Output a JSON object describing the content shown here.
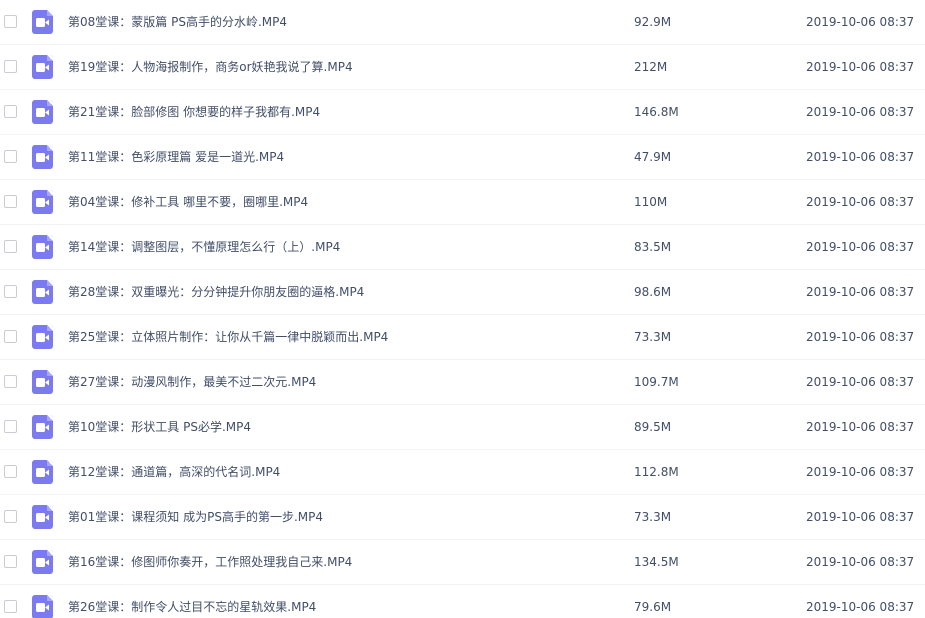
{
  "colors": {
    "icon_bg": "#7b7af0",
    "text": "#424e67",
    "row_divider": "#f2f2f3"
  },
  "files": [
    {
      "name": "第08堂课：蒙版篇 PS高手的分水岭.MP4",
      "size": "92.9M",
      "date": "2019-10-06 08:37",
      "icon": "video-file-icon"
    },
    {
      "name": "第19堂课：人物海报制作，商务or妖艳我说了算.MP4",
      "size": "212M",
      "date": "2019-10-06 08:37",
      "icon": "video-file-icon"
    },
    {
      "name": "第21堂课：脸部修图 你想要的样子我都有.MP4",
      "size": "146.8M",
      "date": "2019-10-06 08:37",
      "icon": "video-file-icon"
    },
    {
      "name": "第11堂课：色彩原理篇 爱是一道光.MP4",
      "size": "47.9M",
      "date": "2019-10-06 08:37",
      "icon": "video-file-icon"
    },
    {
      "name": "第04堂课：修补工具 哪里不要，圈哪里.MP4",
      "size": "110M",
      "date": "2019-10-06 08:37",
      "icon": "video-file-icon"
    },
    {
      "name": "第14堂课：调整图层，不懂原理怎么行（上）.MP4",
      "size": "83.5M",
      "date": "2019-10-06 08:37",
      "icon": "video-file-icon"
    },
    {
      "name": "第28堂课：双重曝光：分分钟提升你朋友圈的逼格.MP4",
      "size": "98.6M",
      "date": "2019-10-06 08:37",
      "icon": "video-file-icon"
    },
    {
      "name": "第25堂课：立体照片制作：让你从千篇一律中脱颖而出.MP4",
      "size": "73.3M",
      "date": "2019-10-06 08:37",
      "icon": "video-file-icon"
    },
    {
      "name": "第27堂课：动漫风制作，最美不过二次元.MP4",
      "size": "109.7M",
      "date": "2019-10-06 08:37",
      "icon": "video-file-icon"
    },
    {
      "name": "第10堂课：形状工具 PS必学.MP4",
      "size": "89.5M",
      "date": "2019-10-06 08:37",
      "icon": "video-file-icon"
    },
    {
      "name": "第12堂课：通道篇，高深的代名词.MP4",
      "size": "112.8M",
      "date": "2019-10-06 08:37",
      "icon": "video-file-icon"
    },
    {
      "name": "第01堂课：课程须知 成为PS高手的第一步.MP4",
      "size": "73.3M",
      "date": "2019-10-06 08:37",
      "icon": "video-file-icon"
    },
    {
      "name": "第16堂课：修图师你奏开，工作照处理我自己来.MP4",
      "size": "134.5M",
      "date": "2019-10-06 08:37",
      "icon": "video-file-icon"
    },
    {
      "name": "第26堂课：制作令人过目不忘的星轨效果.MP4",
      "size": "79.6M",
      "date": "2019-10-06 08:37",
      "icon": "video-file-icon"
    }
  ]
}
